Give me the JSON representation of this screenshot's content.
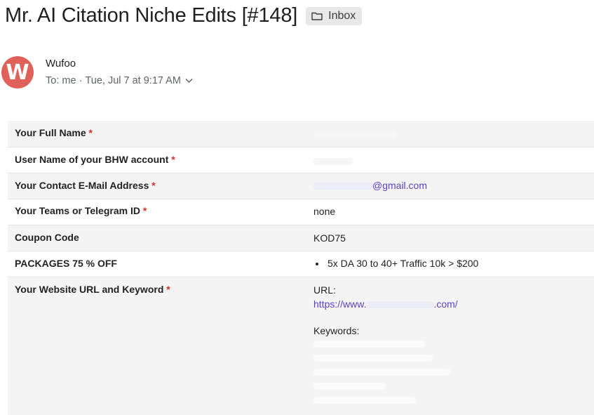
{
  "email": {
    "subject": "Mr. AI Citation Niche Edits [#148]",
    "folder_label": "Inbox",
    "folder_icon": "folder-icon",
    "sender": {
      "name": "Wufoo",
      "avatar_letter": "W",
      "avatar_color": "#e0605a"
    },
    "recipient_prefix": "To:",
    "recipient": "me",
    "date": "Tue, Jul 7 at 9:17 AM",
    "date_sep": "·"
  },
  "form": {
    "required_mark": "*",
    "rows": [
      {
        "label": "Your Full Name",
        "required": true,
        "value": ""
      },
      {
        "label": "User Name of your BHW account",
        "required": true,
        "value": ""
      },
      {
        "label": "Your Contact E-Mail Address",
        "required": true,
        "value": "@gmail.com"
      },
      {
        "label": "Your Teams or Telegram ID",
        "required": true,
        "value": "none"
      },
      {
        "label": "Coupon Code",
        "required": false,
        "value": "KOD75"
      },
      {
        "label": "PACKAGES 75 % OFF",
        "required": false,
        "value": "5x DA 30 to 40+ Traffic 10k > $200"
      },
      {
        "label": "Your Website URL and Keyword",
        "required": true,
        "url_label": "URL:",
        "url_start": "https://www.",
        "url_end": ".com/",
        "keywords_label": "Keywords:"
      }
    ]
  },
  "colors": {
    "accent_link": "#5b3fc7",
    "required": "#d32f2f",
    "row_shade": "#f4f4f4"
  }
}
